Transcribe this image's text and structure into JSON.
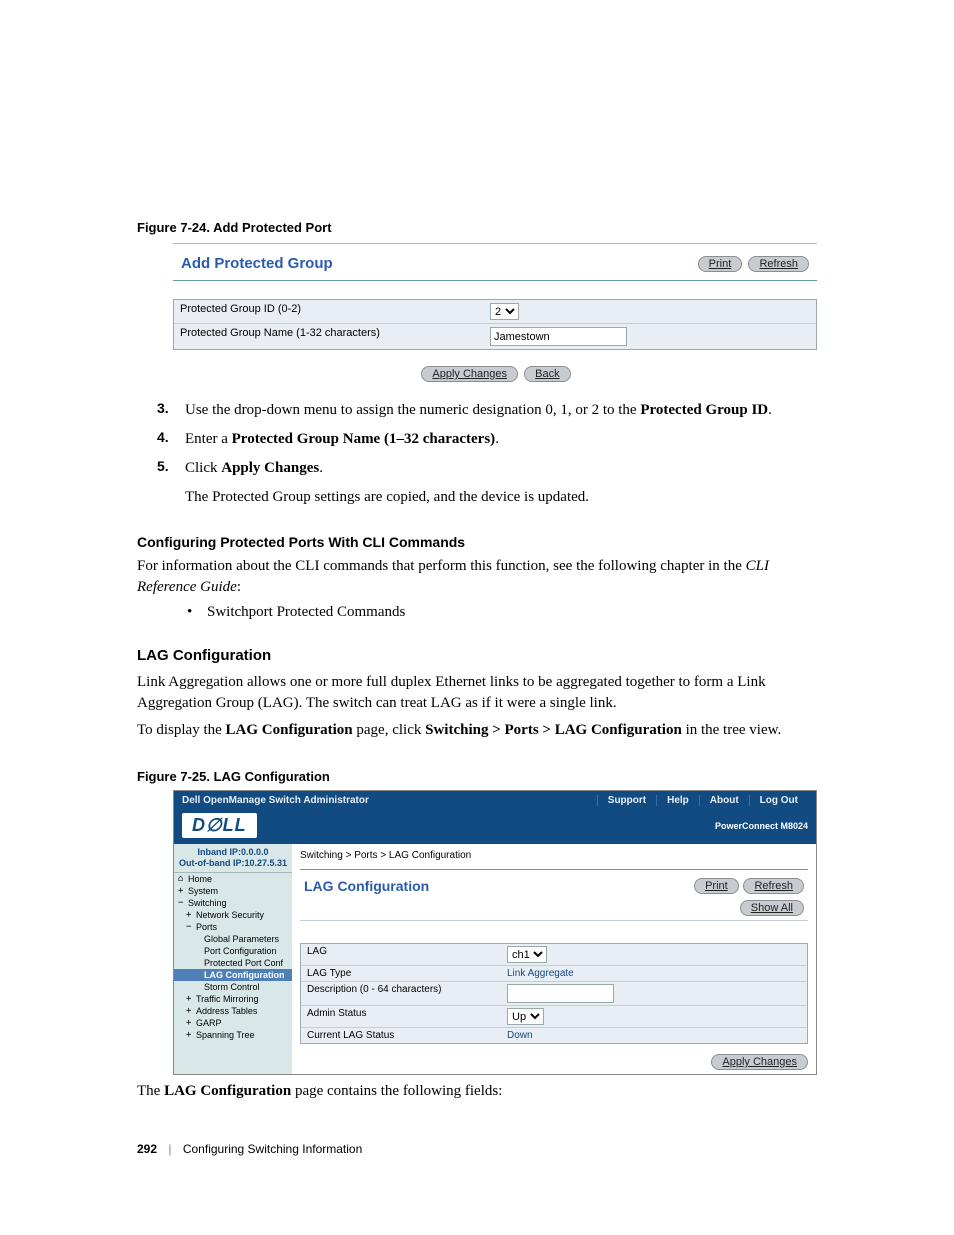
{
  "fig1_caption": "Figure 7-24.    Add Protected Port",
  "shot1": {
    "title": "Add Protected Group",
    "print": "Print",
    "refresh": "Refresh",
    "row1_label": "Protected Group ID (0-2)",
    "row1_value": "2",
    "row2_label": "Protected Group Name (1-32 characters)",
    "row2_value": "Jamestown",
    "apply": "Apply Changes",
    "back": "Back"
  },
  "steps": {
    "s3_num": "3.",
    "s3_a": "Use the drop-down menu to assign the numeric designation 0, 1, or 2 to the ",
    "s3_b": "Protected Group ID",
    "s3_c": ".",
    "s4_num": "4.",
    "s4_a": "Enter a ",
    "s4_b": "Protected Group Name (1–32 characters)",
    "s4_c": ".",
    "s5_num": "5.",
    "s5_a": "Click ",
    "s5_b": "Apply Changes",
    "s5_c": ".",
    "s5_follow": "The Protected Group settings are copied, and the device is updated."
  },
  "h_cli": "Configuring Protected Ports With CLI Commands",
  "cli_p1a": "For information about the CLI commands that perform this function, see the following chapter in the ",
  "cli_p1b": "CLI Reference Guide",
  "cli_p1c": ":",
  "cli_bullet": "Switchport Protected Commands",
  "h_lag": "LAG Configuration",
  "lag_p1": "Link Aggregation allows one or more full duplex Ethernet links to be aggregated together to form a Link Aggregation Group (LAG). The switch can treat LAG as if it were a single link.",
  "lag_p2a": "To display the ",
  "lag_p2b": "LAG Configuration",
  "lag_p2c": " page, click ",
  "lag_p2d": "Switching > Ports > LAG Configuration",
  "lag_p2e": " in the tree view.",
  "fig2_caption": "Figure 7-25.    LAG Configuration",
  "shot2": {
    "topbar_title": "Dell OpenManage Switch Administrator",
    "top_support": "Support",
    "top_help": "Help",
    "top_about": "About",
    "top_logout": "Log Out",
    "product": "PowerConnect M8024",
    "ip_inband": "Inband IP:0.0.0.0",
    "ip_out": "Out-of-band IP:10.27.5.31",
    "nav_home": "Home",
    "nav_system": "System",
    "nav_switching": "Switching",
    "nav_netsec": "Network Security",
    "nav_ports": "Ports",
    "nav_global": "Global Parameters",
    "nav_portconf": "Port Configuration",
    "nav_protport": "Protected Port Conf",
    "nav_lagconf": "LAG Configuration",
    "nav_storm": "Storm Control",
    "nav_traffic": "Traffic Mirroring",
    "nav_addr": "Address Tables",
    "nav_garp": "GARP",
    "nav_span": "Spanning Tree",
    "breadcrumb": "Switching > Ports > LAG Configuration",
    "panel_title": "LAG Configuration",
    "print": "Print",
    "refresh": "Refresh",
    "showall": "Show All",
    "r1_label": "LAG",
    "r1_value": "ch1",
    "r2_label": "LAG Type",
    "r2_value": "Link Aggregate",
    "r3_label": "Description (0 - 64 characters)",
    "r3_value": "",
    "r4_label": "Admin Status",
    "r4_value": "Up",
    "r5_label": "Current LAG Status",
    "r5_value": "Down",
    "apply": "Apply Changes"
  },
  "final_a": "The ",
  "final_b": "LAG Configuration",
  "final_c": " page contains the following fields:",
  "footer_page": "292",
  "footer_chapter": "Configuring Switching Information"
}
